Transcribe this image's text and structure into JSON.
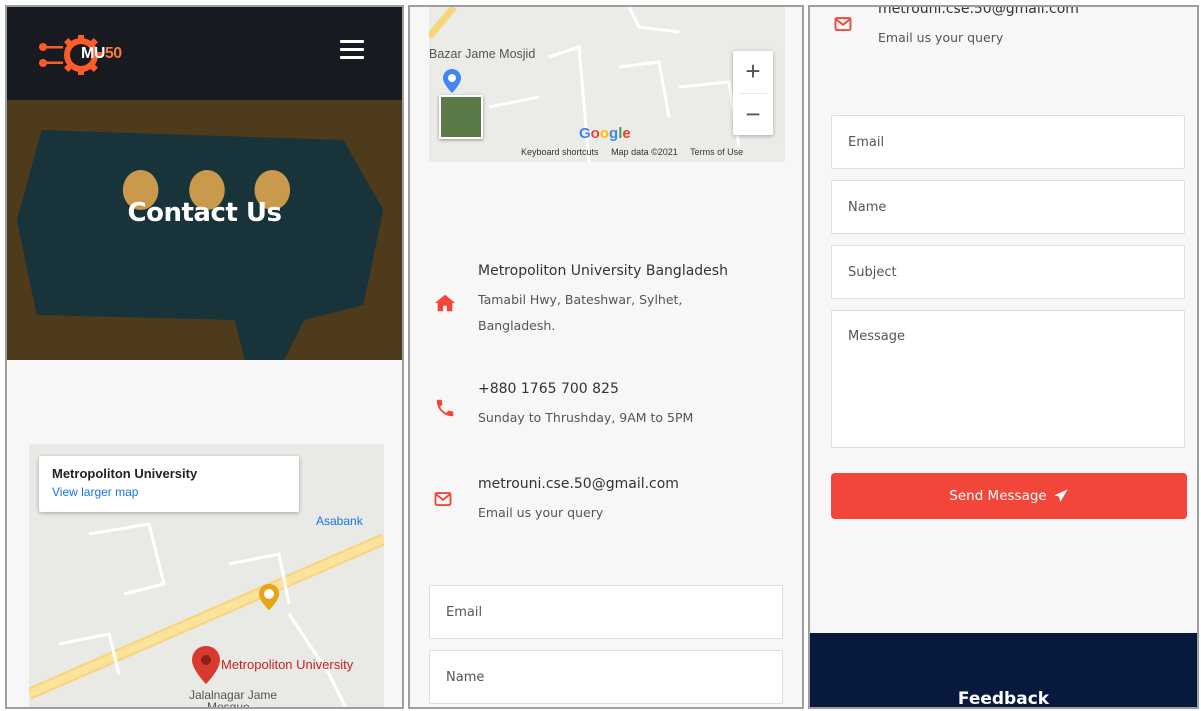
{
  "brand": {
    "logo_text": "MU",
    "logo_num": "50"
  },
  "hero": {
    "title": "Contact Us"
  },
  "map_embed": {
    "card_title": "Metropoliton University",
    "card_link": "View larger map",
    "marker_label": "Metropoliton University",
    "places": [
      "Asabank",
      "Jalalnagar Jame",
      "Mosque"
    ],
    "mosque_label": "Bazar Jame Mosjid",
    "google": "Google",
    "footer": [
      "Keyboard shortcuts",
      "Map data ©2021",
      "Terms of Use"
    ],
    "zoom_in": "+",
    "zoom_out": "−"
  },
  "contact": {
    "address_title": "Metropoliton University Bangladesh",
    "address_line": "Tamabil Hwy, Bateshwar, Sylhet, Bangladesh.",
    "phone": "+880 1765 700 825",
    "hours": "Sunday to Thrushday, 9AM to 5PM",
    "email": "metrouni.cse.50@gmail.com",
    "email_note": "Email us your query",
    "email_partial": "metrouni.cse.50@gmail.com"
  },
  "form": {
    "email": "Email",
    "name": "Name",
    "subject": "Subject",
    "message": "Message",
    "submit": "Send Message"
  },
  "footer": {
    "title": "Feedback"
  },
  "colors": {
    "accent": "#f2463a",
    "footer": "#08193e",
    "topbar": "#181a22"
  },
  "icons": [
    "gear-logo-icon",
    "hamburger-icon",
    "home-icon",
    "phone-icon",
    "envelope-icon",
    "paper-plane-icon",
    "map-pin-icon"
  ]
}
